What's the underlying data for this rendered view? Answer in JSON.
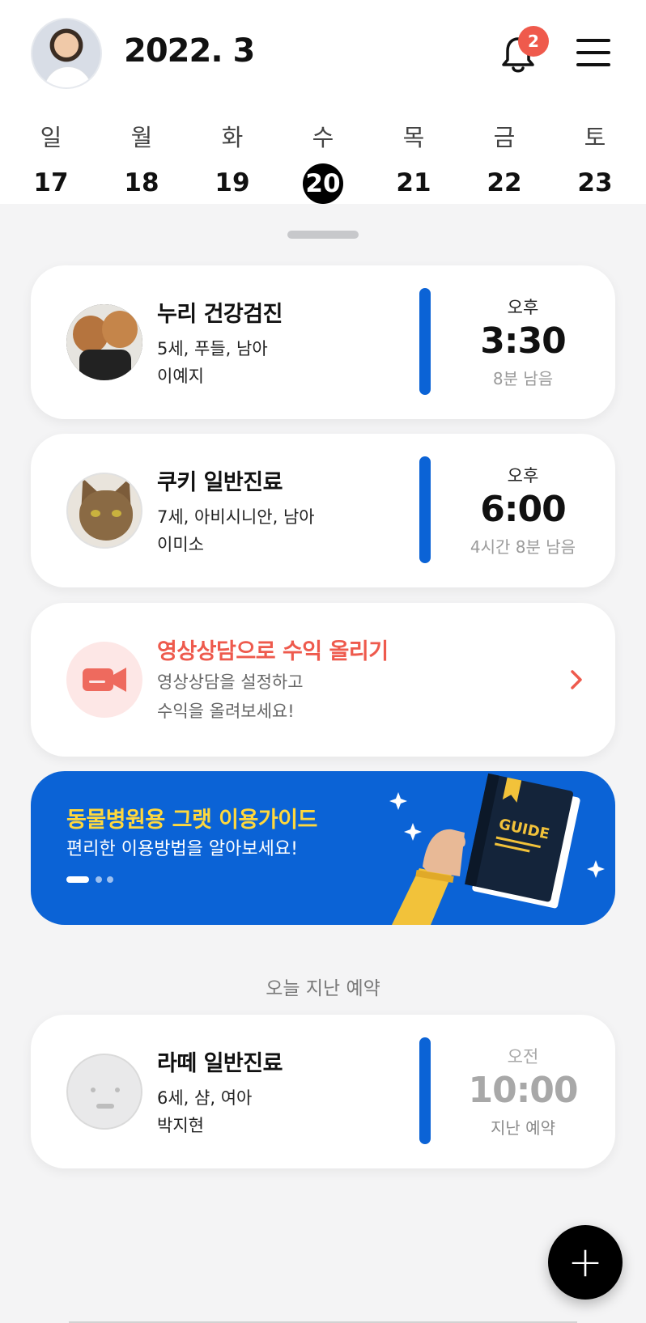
{
  "header": {
    "month": "2022. 3",
    "notification_count": "2"
  },
  "week": [
    {
      "dow": "일",
      "day": "17",
      "selected": false
    },
    {
      "dow": "월",
      "day": "18",
      "selected": false
    },
    {
      "dow": "화",
      "day": "19",
      "selected": false
    },
    {
      "dow": "수",
      "day": "20",
      "selected": true
    },
    {
      "dow": "목",
      "day": "21",
      "selected": false
    },
    {
      "dow": "금",
      "day": "22",
      "selected": false
    },
    {
      "dow": "토",
      "day": "23",
      "selected": false
    }
  ],
  "appointments": [
    {
      "title": "누리 건강검진",
      "pet_info": "5세, 푸들, 남아",
      "owner": "이예지",
      "ampm": "오후",
      "time": "3:30",
      "remaining": "8분 남음"
    },
    {
      "title": "쿠키 일반진료",
      "pet_info": "7세, 아비시니안, 남아",
      "owner": "이미소",
      "ampm": "오후",
      "time": "6:00",
      "remaining": "4시간 8분 남음"
    }
  ],
  "promo": {
    "title": "영상상담으로 수익 올리기",
    "line1": "영상상담을 설정하고",
    "line2": "수익을 올려보세요!"
  },
  "banner": {
    "title": "동물병원용 그랫 이용가이드",
    "subtitle": "편리한 이용방법을 알아보세요!",
    "book_label": "GUIDE"
  },
  "past_section": {
    "label": "오늘 지난 예약",
    "items": [
      {
        "title": "라떼 일반진료",
        "pet_info": "6세, 샴, 여아",
        "owner": "박지현",
        "ampm": "오전",
        "time": "10:00",
        "status": "지난 예약"
      }
    ]
  },
  "fab": {
    "label": "+"
  },
  "colors": {
    "accent_blue": "#0b63d6",
    "accent_red": "#ee5a4d",
    "banner_yellow": "#ffd83d",
    "background": "#f4f4f5"
  },
  "icons": [
    "profile-avatar",
    "bell-icon",
    "hamburger-menu-icon",
    "video-camera-icon",
    "chevron-right-icon",
    "plus-icon"
  ]
}
